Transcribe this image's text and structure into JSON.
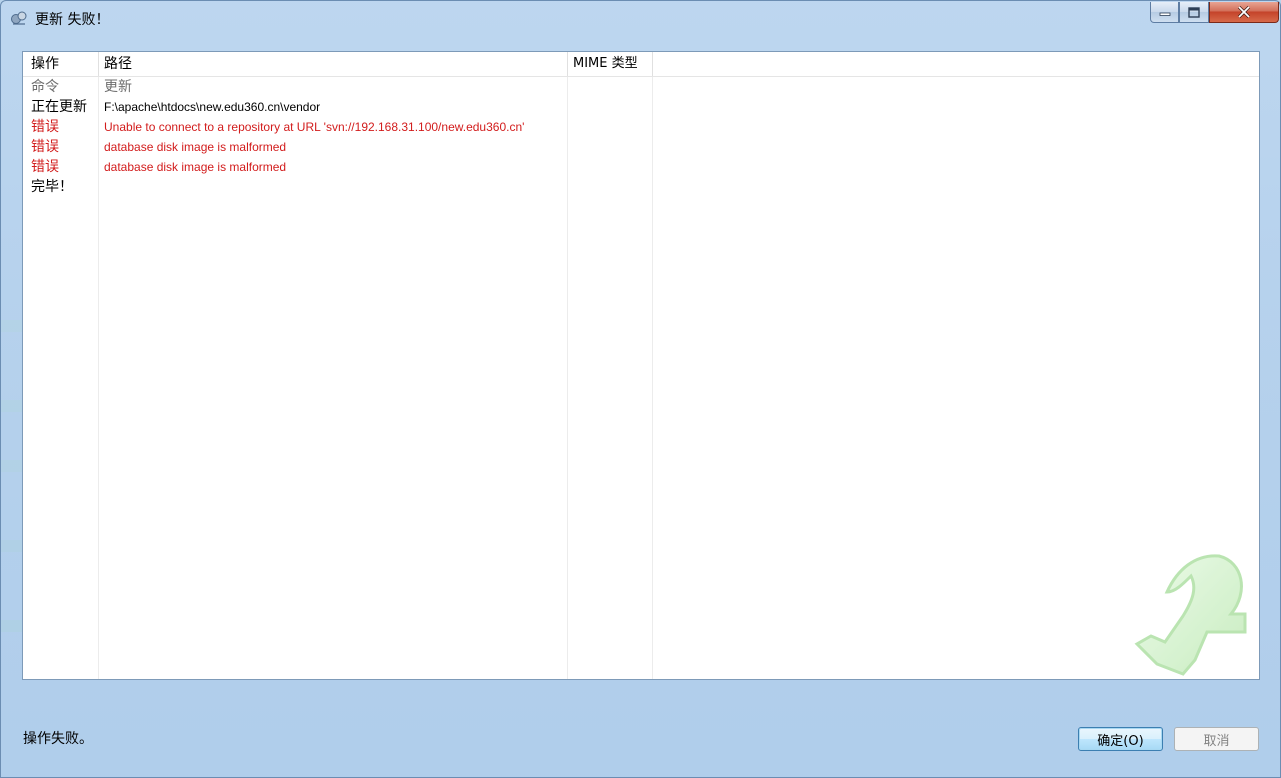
{
  "window": {
    "title": "更新 失败！"
  },
  "table": {
    "columns": [
      "操作",
      "路径",
      "MIME 类型"
    ],
    "rows": [
      {
        "action": "命令",
        "path": "更新",
        "color": "#6d6d6d"
      },
      {
        "action": "正在更新",
        "path": "F:\\apache\\htdocs\\new.edu360.cn\\vendor",
        "color": "#000000"
      },
      {
        "action": "错误",
        "path": "Unable to connect to a repository at URL 'svn://192.168.31.100/new.edu360.cn'",
        "color": "#d21c1c"
      },
      {
        "action": "错误",
        "path": "database disk image is malformed",
        "color": "#d21c1c"
      },
      {
        "action": "错误",
        "path": "database disk image is malformed",
        "color": "#d21c1c"
      },
      {
        "action": "完毕！",
        "path": "",
        "color": "#000000"
      }
    ]
  },
  "status": {
    "text": "操作失败。"
  },
  "buttons": {
    "ok_label": "确定(O)",
    "cancel_label": "取消"
  },
  "icons": {
    "app": "tortoisesvn-icon",
    "minimize": "minimize-icon",
    "maximize": "maximize-icon",
    "close": "close-icon",
    "watermark": "update-arrow-icon"
  },
  "colors": {
    "error": "#d21c1c",
    "command": "#6d6d6d",
    "normal": "#000000"
  }
}
